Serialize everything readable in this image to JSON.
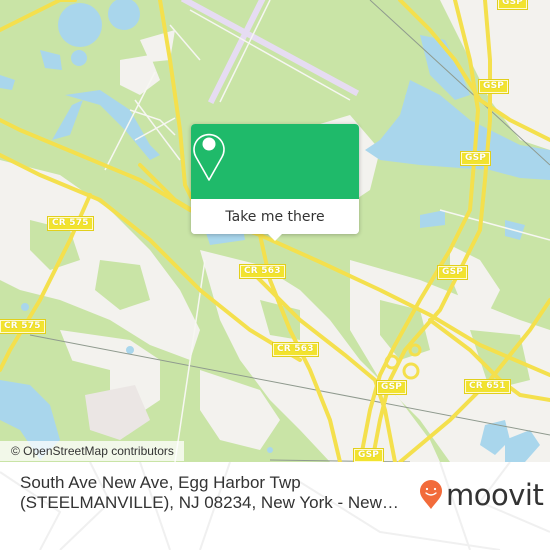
{
  "map": {
    "colors": {
      "land_green": "#c9e4a6",
      "urban": "#f3f2ee",
      "water": "#a9d6ec",
      "road": "#f4e04d",
      "runway": "#e6dcf2"
    },
    "road_labels": [
      {
        "id": "gsp-top-right",
        "text": "GSP"
      },
      {
        "id": "gsp-upper",
        "text": "GSP"
      },
      {
        "id": "gsp-mid-right",
        "text": "GSP"
      },
      {
        "id": "cr575-upper",
        "text": "CR 575"
      },
      {
        "id": "cr575-left",
        "text": "CR 575"
      },
      {
        "id": "cr563-center",
        "text": "CR 563"
      },
      {
        "id": "cr563-lower",
        "text": "CR 563"
      },
      {
        "id": "gsp-interchange",
        "text": "GSP"
      },
      {
        "id": "cr651",
        "text": "CR 651"
      },
      {
        "id": "gsp-bottom",
        "text": "GSP"
      }
    ],
    "popup": {
      "icon": "map-pin-icon",
      "button_label": "Take me there"
    },
    "attribution": "© OpenStreetMap contributors"
  },
  "footer": {
    "address": "South Ave New Ave, Egg Harbor Twp (STEELMANVILLE), NJ 08234, New York - New…",
    "logo": {
      "icon": "moovit-smiley-pin-icon",
      "text": "moovit",
      "color": "#f26b3a"
    }
  }
}
